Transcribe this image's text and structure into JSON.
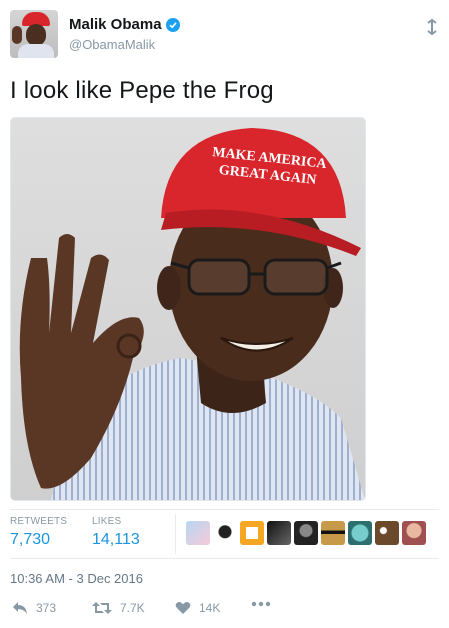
{
  "author": {
    "display_name": "Malik Obama",
    "handle": "@ObamaMalik",
    "verified": true,
    "avatar_icon": "avatar"
  },
  "tweet": {
    "text": "I look like Pepe the Frog",
    "photo": {
      "cap_text_line1": "MAKE AMERICA",
      "cap_text_line2": "GREAT AGAIN"
    }
  },
  "stats": {
    "retweets_label": "RETWEETS",
    "retweets_value": "7,730",
    "likes_label": "LIKES",
    "likes_value": "14,113",
    "liker_avatars": [
      "liker-avatar-1",
      "liker-avatar-2",
      "liker-avatar-3",
      "liker-avatar-4",
      "liker-avatar-5",
      "liker-avatar-6",
      "liker-avatar-7",
      "liker-avatar-8",
      "liker-avatar-9"
    ]
  },
  "timestamp": "10:36 AM - 3 Dec 2016",
  "actions": {
    "reply_count": "373",
    "retweet_count": "7.7K",
    "like_count": "14K"
  },
  "colors": {
    "accent": "#1b95e0",
    "verified": "#1da1f2",
    "muted": "#8899a6",
    "cap_red": "#d8262c"
  }
}
